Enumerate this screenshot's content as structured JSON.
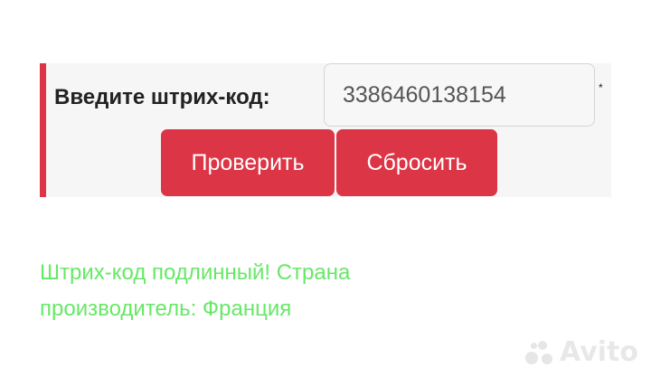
{
  "form": {
    "label": "Введите штрих-код:",
    "barcode_value": "3386460138154",
    "required_mark": "*",
    "check_button": "Проверить",
    "reset_button": "Сбросить"
  },
  "result": {
    "line1": "Штрих-код подлинный! Страна",
    "line2": "производитель: Франция"
  },
  "watermark": {
    "text": "Avito"
  },
  "colors": {
    "accent": "#dc3545",
    "result_text": "#66e866"
  }
}
